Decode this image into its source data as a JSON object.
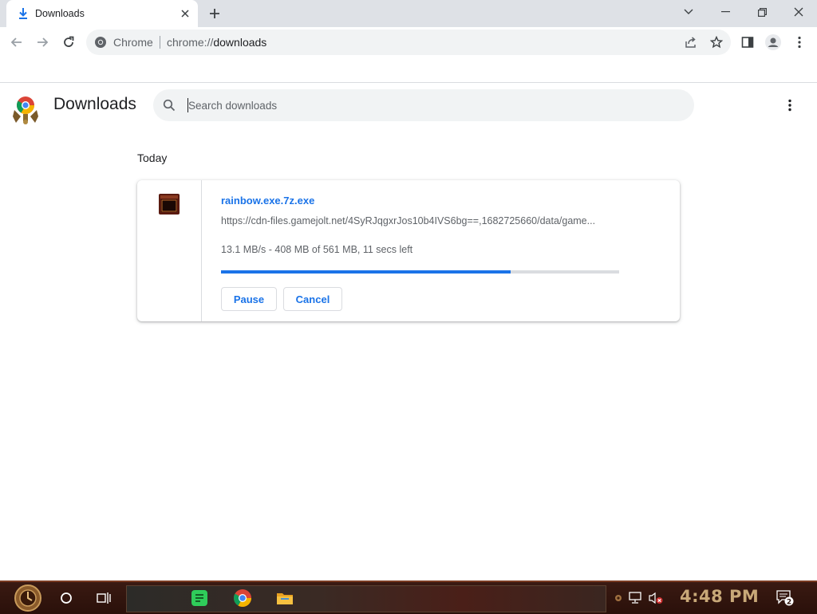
{
  "tab": {
    "title": "Downloads"
  },
  "toolbar": {
    "site_label": "Chrome",
    "url_scheme": "chrome://",
    "url_host": "downloads"
  },
  "page": {
    "title": "Downloads",
    "search_placeholder": "Search downloads"
  },
  "downloads": {
    "section_date": "Today",
    "items": [
      {
        "file_name": "rainbow.exe.7z.exe",
        "url": "https://cdn-files.gamejolt.net/4SyRJqgxrJos10b4IVS6bg==,1682725660/data/game...",
        "status": "13.1 MB/s - 408 MB of 561 MB, 11 secs left",
        "progress_percent": 72.7,
        "pause_label": "Pause",
        "cancel_label": "Cancel"
      }
    ]
  },
  "taskbar": {
    "clock": "4:48 PM",
    "notification_count": "2"
  },
  "colors": {
    "accent": "#1a73e8",
    "tabstrip": "#dee1e6",
    "omnibox": "#f1f3f4",
    "taskbar": "#2a100a",
    "clock": "#c8a878"
  },
  "icons": {
    "tab": "download-icon",
    "back": "arrow-left-icon",
    "forward": "arrow-right-icon",
    "reload": "reload-icon",
    "share": "share-icon",
    "bookmark": "star-icon",
    "side_panel": "side-panel-icon",
    "profile": "profile-icon",
    "menu": "kebab-menu-icon",
    "search": "search-icon"
  }
}
